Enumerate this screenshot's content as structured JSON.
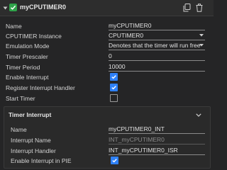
{
  "header": {
    "title": "myCPUTIMER0"
  },
  "rows": [
    {
      "label": "Name",
      "value": "myCPUTIMER0"
    },
    {
      "label": "CPUTIMER Instance",
      "value": "CPUTIMER0"
    },
    {
      "label": "Emulation Mode",
      "value": "Denotes that the timer will run free"
    },
    {
      "label": "Timer Prescaler",
      "value": "0"
    },
    {
      "label": "Timer Period",
      "value": "10000"
    },
    {
      "label": "Enable Interrupt",
      "checked": true
    },
    {
      "label": "Register Interrupt Handler",
      "checked": true
    },
    {
      "label": "Start Timer",
      "checked": false
    }
  ],
  "timer_interrupt": {
    "title": "Timer Interrupt",
    "rows": [
      {
        "label": "Name",
        "value": "myCPUTIMER0_INT"
      },
      {
        "label": "Interrupt Name",
        "value": "INT_myCPUTIMER0"
      },
      {
        "label": "Interrupt Handler",
        "value": "INT_myCPUTIMER0_ISR"
      },
      {
        "label": "Enable Interrupt in PIE",
        "checked": true
      }
    ]
  },
  "colors": {
    "accent": "#2f81f7",
    "status_ok": "#2fa34a",
    "background": "#252526"
  }
}
